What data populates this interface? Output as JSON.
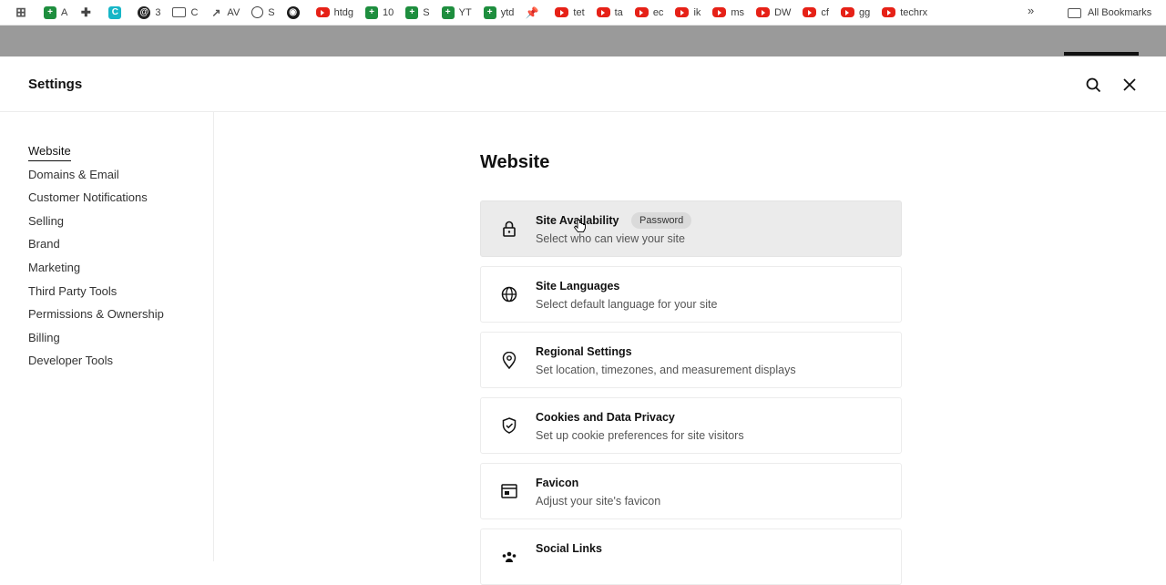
{
  "bookmarks": [
    {
      "icon": "apps-icon",
      "label": ""
    },
    {
      "icon": "sheet-icon",
      "label": "A"
    },
    {
      "icon": "puzzle-icon",
      "label": ""
    },
    {
      "icon": "canva-icon",
      "label": ""
    },
    {
      "icon": "threads-icon",
      "label": "3"
    },
    {
      "icon": "folder-icon",
      "label": "C"
    },
    {
      "icon": "chart-icon",
      "label": "AV"
    },
    {
      "icon": "globe-icon",
      "label": "S"
    },
    {
      "icon": "github-icon",
      "label": ""
    },
    {
      "icon": "youtube-icon",
      "label": "htdg"
    },
    {
      "icon": "sheet-icon",
      "label": "10"
    },
    {
      "icon": "sheet-icon",
      "label": "S"
    },
    {
      "icon": "sheet-icon",
      "label": "YT"
    },
    {
      "icon": "sheet-icon",
      "label": "ytd"
    },
    {
      "icon": "pin-icon",
      "label": ""
    },
    {
      "icon": "youtube-icon",
      "label": "tet"
    },
    {
      "icon": "youtube-icon",
      "label": "ta"
    },
    {
      "icon": "youtube-icon",
      "label": "ec"
    },
    {
      "icon": "youtube-icon",
      "label": "ik"
    },
    {
      "icon": "youtube-icon",
      "label": "ms"
    },
    {
      "icon": "youtube-icon",
      "label": "DW"
    },
    {
      "icon": "youtube-icon",
      "label": "cf"
    },
    {
      "icon": "youtube-icon",
      "label": "gg"
    },
    {
      "icon": "youtube-icon",
      "label": "techrx"
    }
  ],
  "bookmarks_more": "»",
  "all_bookmarks": "All Bookmarks",
  "header": {
    "title": "Settings"
  },
  "sidebar": {
    "items": [
      {
        "label": "Website",
        "active": true
      },
      {
        "label": "Domains & Email"
      },
      {
        "label": "Customer Notifications"
      },
      {
        "label": "Selling"
      },
      {
        "label": "Brand"
      },
      {
        "label": "Marketing"
      },
      {
        "label": "Third Party Tools"
      },
      {
        "label": "Permissions & Ownership"
      },
      {
        "label": "Billing"
      },
      {
        "label": "Developer Tools"
      }
    ]
  },
  "main": {
    "title": "Website",
    "cards": [
      {
        "icon": "lock-icon",
        "title": "Site Availability",
        "badge": "Password",
        "desc": "Select who can view your site"
      },
      {
        "icon": "globe-icon",
        "title": "Site Languages",
        "desc": "Select default language for your site"
      },
      {
        "icon": "location-pin-icon",
        "title": "Regional Settings",
        "desc": "Set location, timezones, and measurement displays"
      },
      {
        "icon": "shield-check-icon",
        "title": "Cookies and Data Privacy",
        "desc": "Set up cookie preferences for site visitors"
      },
      {
        "icon": "browser-window-icon",
        "title": "Favicon",
        "desc": "Adjust your site's favicon"
      },
      {
        "icon": "people-icon",
        "title": "Social Links",
        "desc": ""
      }
    ]
  }
}
